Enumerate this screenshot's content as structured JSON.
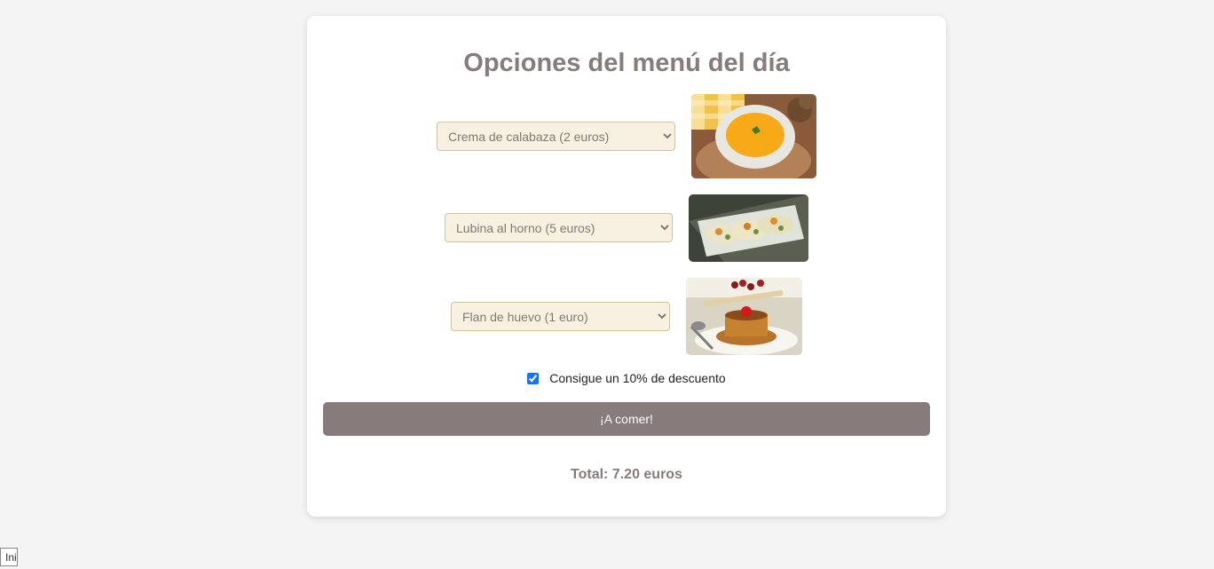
{
  "menu": {
    "title": "Opciones del menú del día",
    "starter": {
      "selected": "Crema de calabaza (2 euros)",
      "image": "pumpkin-cream-soup"
    },
    "main": {
      "selected": "Lubina al horno (5 euros)",
      "image": "baked-sea-bass"
    },
    "dessert": {
      "selected": "Flan de huevo (1 euro)",
      "image": "egg-flan"
    },
    "discount": {
      "label": "Consigue un 10% de descuento",
      "checked": true
    },
    "submit_label": "¡A comer!",
    "total": "Total: 7.20 euros"
  },
  "footer": {
    "corner_tab_label": "Ini"
  },
  "colors": {
    "accent": "#877b7b",
    "select_bg": "#f8f1e1",
    "page_bg": "#f4f4f4"
  }
}
